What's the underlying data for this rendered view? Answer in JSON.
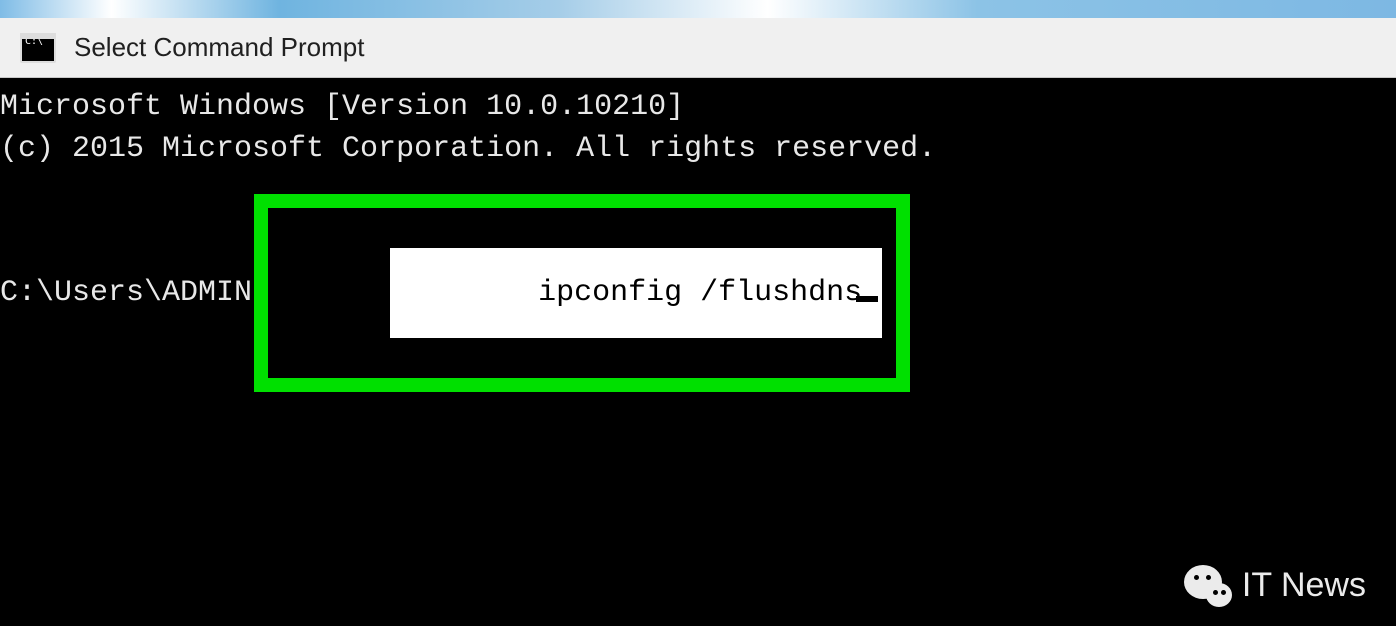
{
  "title_bar": {
    "icon_name": "cmd-icon",
    "title": "Select Command Prompt"
  },
  "terminal": {
    "line1": "Microsoft Windows [Version 10.0.10210]",
    "line2": "(c) 2015 Microsoft Corporation. All rights reserved.",
    "prompt_path": "C:\\Users\\ADMIN",
    "command": "ipconfig /flushdns",
    "highlight_color": "#00e000"
  },
  "watermark": {
    "text": "IT News",
    "icon_name": "wechat-icon"
  }
}
